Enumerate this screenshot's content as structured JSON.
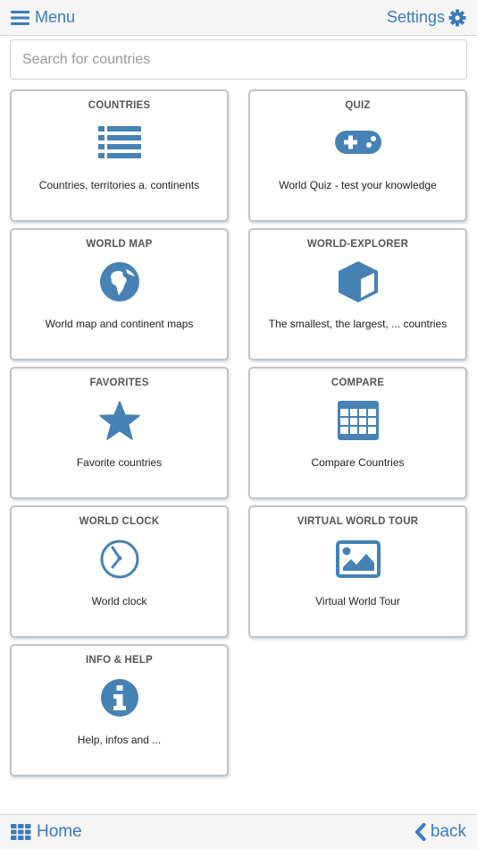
{
  "header": {
    "menu_label": "Menu",
    "settings_label": "Settings"
  },
  "search": {
    "placeholder": "Search for countries",
    "value": ""
  },
  "tiles": [
    {
      "title": "COUNTRIES",
      "icon": "list-icon",
      "description": "Countries, territories a. continents"
    },
    {
      "title": "QUIZ",
      "icon": "gamepad-icon",
      "description": "World Quiz - test your knowledge"
    },
    {
      "title": "WORLD MAP",
      "icon": "globe-icon",
      "description": "World map and continent maps"
    },
    {
      "title": "WORLD-EXPLORER",
      "icon": "cube-icon",
      "description": "The smallest, the largest, ... countries"
    },
    {
      "title": "FAVORITES",
      "icon": "star-icon",
      "description": "Favorite countries"
    },
    {
      "title": "COMPARE",
      "icon": "table-icon",
      "description": "Compare Countries"
    },
    {
      "title": "WORLD CLOCK",
      "icon": "clock-icon",
      "description": "World clock"
    },
    {
      "title": "VIRTUAL WORLD TOUR",
      "icon": "image-icon",
      "description": "Virtual World Tour"
    },
    {
      "title": "INFO & HELP",
      "icon": "info-icon",
      "description": "Help, infos and ..."
    }
  ],
  "footer": {
    "home_label": "Home",
    "back_label": "back"
  },
  "colors": {
    "accent": "#3b7bbf",
    "icon": "#4682b4",
    "bar_background": "#f6f6f6",
    "card_border": "#c3c3c3"
  }
}
